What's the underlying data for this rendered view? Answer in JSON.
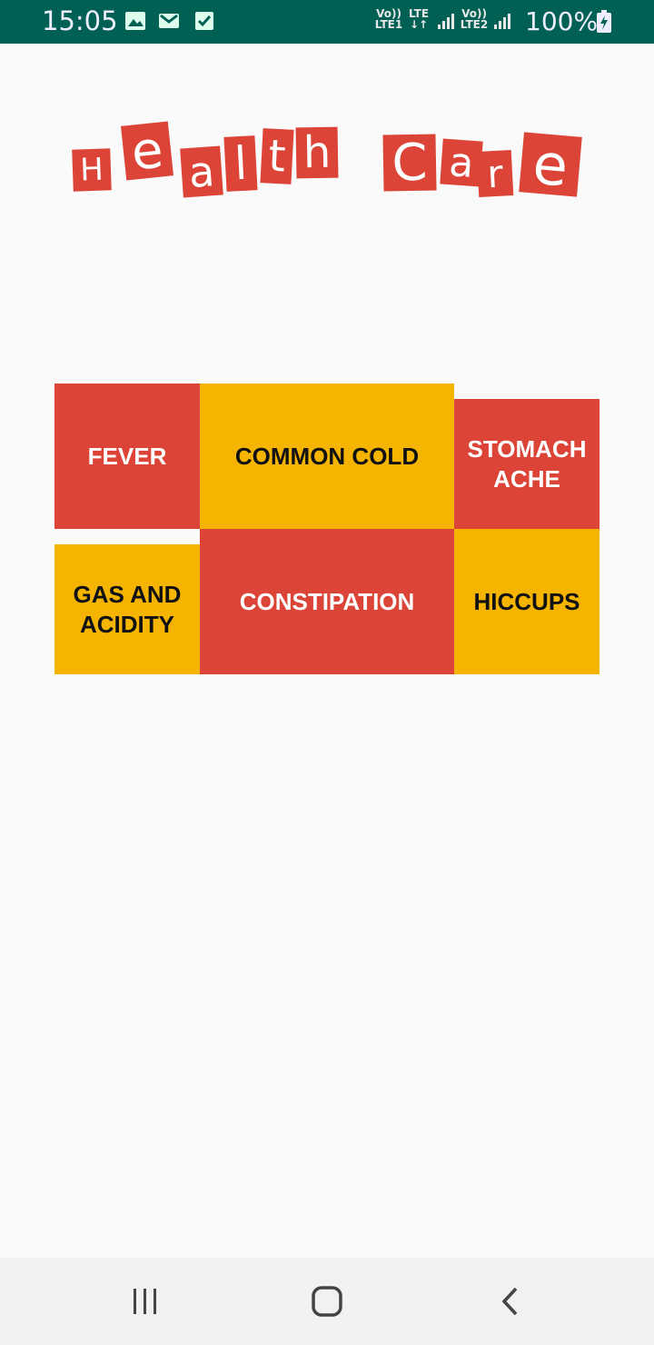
{
  "status_bar": {
    "time": "15:05",
    "sim1": {
      "top": "Vo))",
      "bottom": "LTE1"
    },
    "lte": {
      "top": "LTE",
      "bottom": "↓↑"
    },
    "sim2": {
      "top": "Vo))",
      "bottom": "LTE2"
    },
    "battery": "100%",
    "icons": [
      "image-icon",
      "gmail-icon",
      "check-icon",
      "signal-icon",
      "battery-charging-icon"
    ],
    "color": "#006054"
  },
  "logo": {
    "letters": [
      "H",
      "e",
      "a",
      "l",
      "t",
      "h",
      "C",
      "a",
      "r",
      "e"
    ],
    "color": "#dc4437"
  },
  "categories": [
    {
      "label": "FEVER",
      "color": "#dc4437"
    },
    {
      "label": "COMMON COLD",
      "color": "#f4b400"
    },
    {
      "label": "STOMACH ACHE",
      "color": "#dc4437"
    },
    {
      "label": "GAS AND ACIDITY",
      "color": "#f4b400"
    },
    {
      "label": "CONSTIPATION",
      "color": "#dc4437"
    },
    {
      "label": "HICCUPS",
      "color": "#f4b400"
    }
  ],
  "nav_bar": {
    "icons": [
      "recent-apps-icon",
      "home-icon",
      "back-icon"
    ]
  }
}
